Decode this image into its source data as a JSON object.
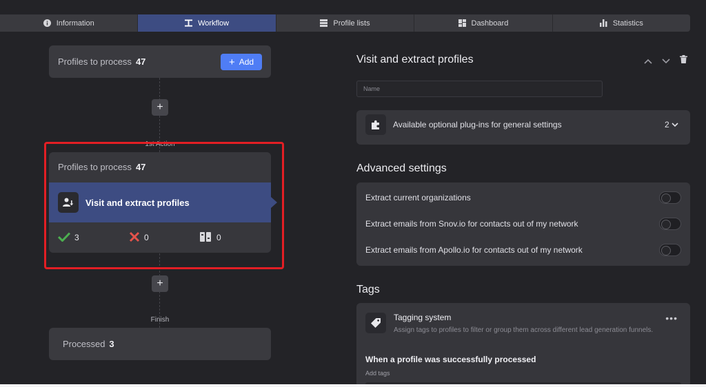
{
  "tabs": [
    {
      "label": "Information",
      "icon": "info-icon"
    },
    {
      "label": "Workflow",
      "icon": "workflow-icon",
      "active": true
    },
    {
      "label": "Profile lists",
      "icon": "list-icon"
    },
    {
      "label": "Dashboard",
      "icon": "dashboard-icon"
    },
    {
      "label": "Statistics",
      "icon": "bar-chart-icon"
    }
  ],
  "workflow": {
    "start_card": {
      "label": "Profiles to process",
      "count": "47",
      "add_label": "Add"
    },
    "first_action_label": "1st Action",
    "action": {
      "queue_label": "Profiles to process",
      "queue_count": "47",
      "name": "Visit and extract profiles",
      "success_count": "3",
      "failed_count": "0",
      "skipped_count": "0"
    },
    "finish_label": "Finish",
    "finish_card": {
      "label": "Processed",
      "count": "3"
    }
  },
  "detail": {
    "title": "Visit and extract profiles",
    "name_placeholder": "Name",
    "plugins_label": "Available optional plug-ins for general settings",
    "plugins_count": "2",
    "advanced_title": "Advanced settings",
    "settings": [
      {
        "label": "Extract current organizations",
        "enabled": false
      },
      {
        "label": "Extract emails from Snov.io for contacts out of my network",
        "enabled": false
      },
      {
        "label": "Extract emails from Apollo.io for contacts out of my network",
        "enabled": false
      }
    ],
    "tags_title": "Tags",
    "tagging": {
      "title": "Tagging system",
      "description": "Assign tags to profiles to filter or group them across different lead generation funnels.",
      "when_label": "When a profile was successfully processed",
      "add_tags_label": "Add tags"
    }
  },
  "colors": {
    "accent": "#4f7df5",
    "active_tab": "#3d4c82",
    "highlight": "#e31e24",
    "success": "#4caf50",
    "error": "#e5534b"
  }
}
